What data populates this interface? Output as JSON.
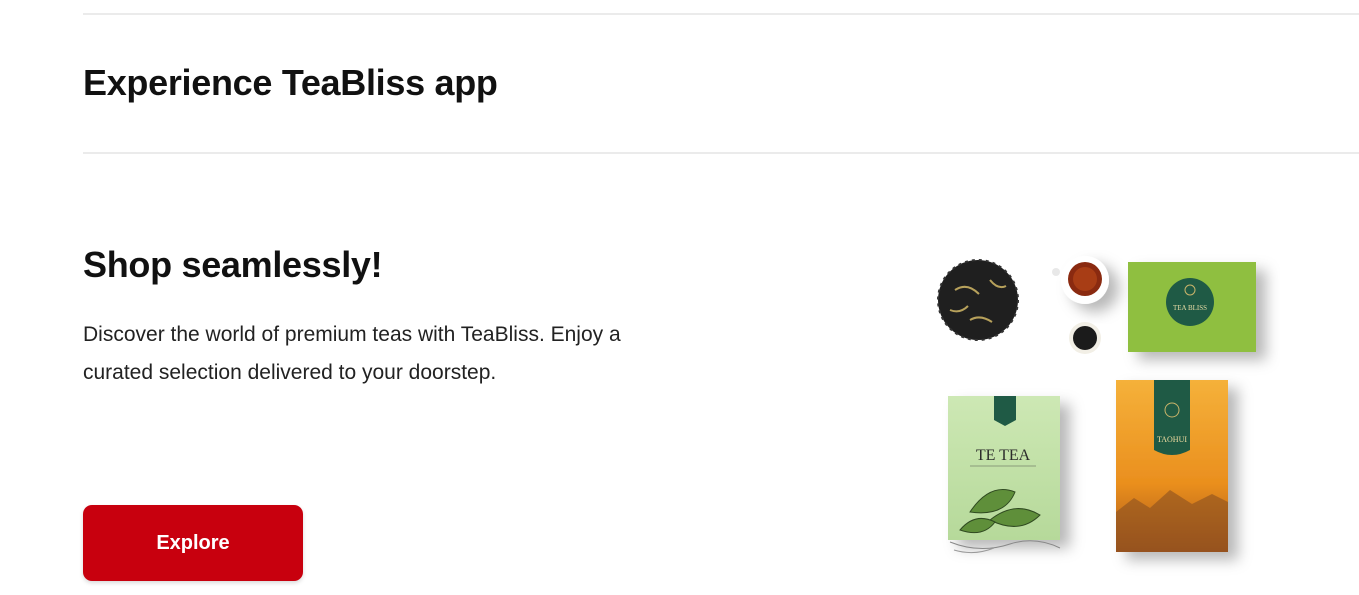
{
  "section": {
    "title": "Experience TeaBliss app"
  },
  "promo": {
    "title": "Shop seamlessly!",
    "description": "Discover the world of premium teas with TeaBliss. Enjoy a curated selection delivered to your doorstep.",
    "button_label": "Explore"
  },
  "illustration": {
    "box_label_small": "TEA BLISS",
    "box_label_green": "TE TEA",
    "box_label_orange": "TAOHUI"
  },
  "colors": {
    "accent": "#c8000e",
    "box_green": "#8fbf3f",
    "box_light_green": "#bfe0a6",
    "box_orange": "#f0a02a",
    "label_dark_green": "#1f5a45"
  }
}
